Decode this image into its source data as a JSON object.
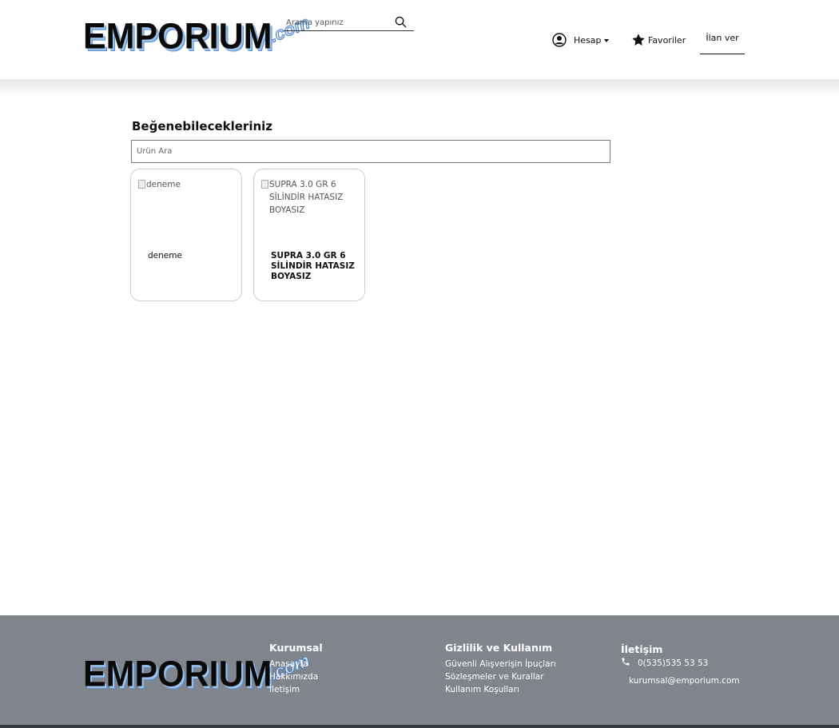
{
  "header": {
    "logo_main": "EMPORIUM",
    "logo_suffix": ".com",
    "search_placeholder": "Arama yapınız",
    "account_label": "Hesap",
    "favorites_label": "Favoriler",
    "post_ad_label": "İlan ver"
  },
  "main": {
    "title": "Beğenebilecekleriniz",
    "product_search_placeholder": "Ürün Ara",
    "products": [
      {
        "image_alt": "deneme",
        "name": "deneme"
      },
      {
        "image_alt": "SUPRA 3.0 GR 6 SİLİNDİR HATASIZ BOYASIZ",
        "name": "SUPRA 3.0 GR 6 SİLİNDİR HATASIZ BOYASIZ"
      }
    ]
  },
  "footer": {
    "logo_main": "EMPORIUM",
    "logo_suffix": ".com",
    "corporate": {
      "heading": "Kurumsal",
      "links": [
        "Anasayfa",
        "Hakkımızda",
        "İletişim"
      ]
    },
    "privacy": {
      "heading": "Gizlilik ve Kullanım",
      "links": [
        "Güvenli Alışverişin İpuçları",
        "Sözleşmeler ve Kurallar",
        "Kullanım Koşulları"
      ]
    },
    "contact": {
      "heading": "İletişim",
      "phone": "0(535)535 53 53",
      "email": "kurumsal@emporium.com"
    }
  },
  "colors": {
    "footer_bg": "#80848b",
    "logo_accent": "#5d8fcf"
  }
}
